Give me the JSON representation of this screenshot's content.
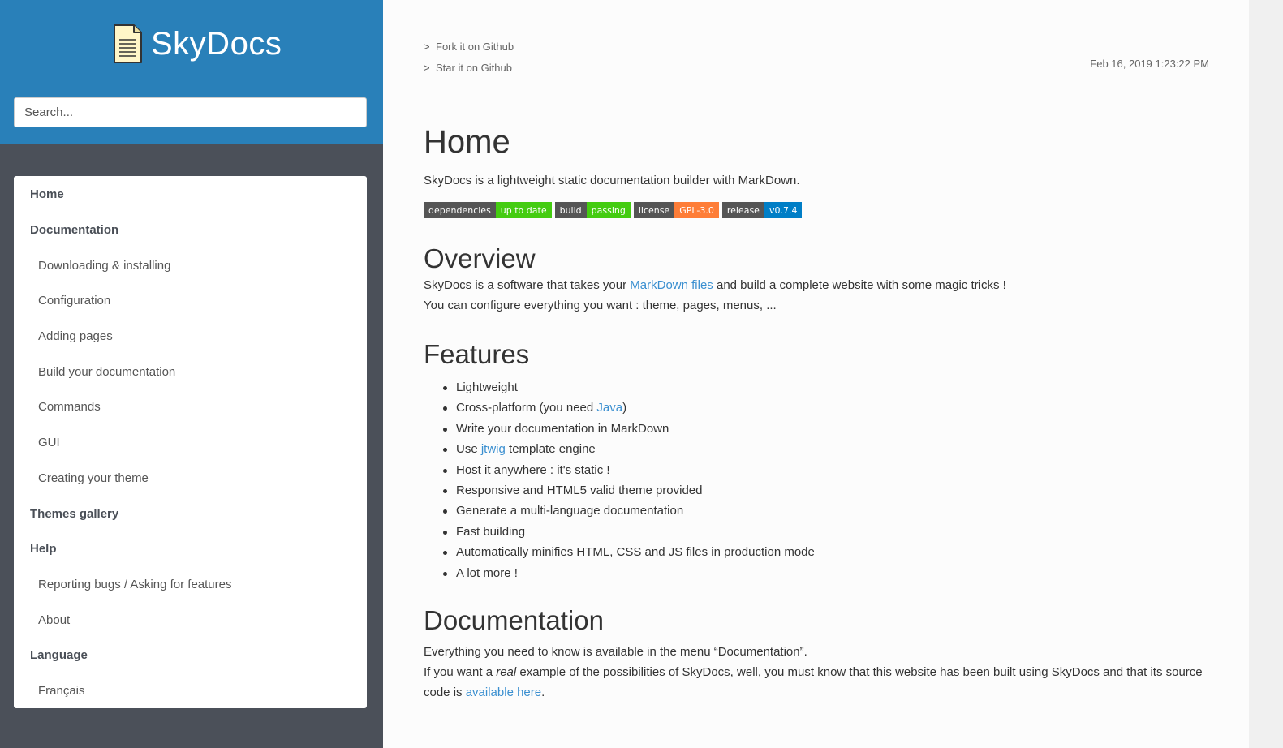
{
  "sidebar": {
    "logo_text": "SkyDocs",
    "search_placeholder": "Search...",
    "items": [
      {
        "label": "Home",
        "level": "top"
      },
      {
        "label": "Documentation",
        "level": "top"
      },
      {
        "label": "Downloading & installing",
        "level": "sub"
      },
      {
        "label": "Configuration",
        "level": "sub"
      },
      {
        "label": "Adding pages",
        "level": "sub"
      },
      {
        "label": "Build your documentation",
        "level": "sub"
      },
      {
        "label": "Commands",
        "level": "sub"
      },
      {
        "label": "GUI",
        "level": "sub"
      },
      {
        "label": "Creating your theme",
        "level": "sub"
      },
      {
        "label": "Themes gallery",
        "level": "top"
      },
      {
        "label": "Help",
        "level": "top"
      },
      {
        "label": "Reporting bugs / Asking for features",
        "level": "sub"
      },
      {
        "label": "About",
        "level": "sub"
      },
      {
        "label": "Language",
        "level": "top"
      },
      {
        "label": "Français",
        "level": "sub"
      }
    ]
  },
  "topbar": {
    "fork_label": "Fork it on Github",
    "star_label": "Star it on Github",
    "arrow": ">",
    "date": "Feb 16, 2019 1:23:22 PM"
  },
  "content": {
    "title": "Home",
    "intro": "SkyDocs is a lightweight static documentation builder with MarkDown.",
    "badges": [
      {
        "label": "dependencies",
        "value": "up to date",
        "color": "#4c1"
      },
      {
        "label": "build",
        "value": "passing",
        "color": "#4c1"
      },
      {
        "label": "license",
        "value": "GPL-3.0",
        "color": "#fe7d37"
      },
      {
        "label": "release",
        "value": "v0.7.4",
        "color": "#007ec6"
      }
    ],
    "overview": {
      "heading": "Overview",
      "p1_before": "SkyDocs is a software that takes your ",
      "p1_link": "MarkDown files",
      "p1_after": " and build a complete website with some magic tricks !",
      "p2": "You can configure everything you want : theme, pages, menus, ..."
    },
    "features": {
      "heading": "Features",
      "items": [
        {
          "text": "Lightweight"
        },
        {
          "before": "Cross-platform (you need ",
          "link": "Java",
          "after": ")"
        },
        {
          "text": "Write your documentation in MarkDown"
        },
        {
          "before": "Use ",
          "link": "jtwig",
          "after": " template engine"
        },
        {
          "text": "Host it anywhere : it's static !"
        },
        {
          "text": "Responsive and HTML5 valid theme provided"
        },
        {
          "text": "Generate a multi-language documentation"
        },
        {
          "text": "Fast building"
        },
        {
          "text": "Automatically minifies HTML, CSS and JS files in production mode"
        },
        {
          "text": "A lot more !"
        }
      ]
    },
    "documentation": {
      "heading": "Documentation",
      "p1": "Everything you need to know is available in the menu “Documentation”.",
      "p2_before": "If you want a ",
      "p2_em": "real",
      "p2_middle": " example of the possibilities of SkyDocs, well, you must know that this website has been built using SkyDocs and that its source code is ",
      "p2_link": "available here",
      "p2_after": "."
    }
  },
  "colors": {
    "header_blue": "#2980b9",
    "sidebar_dark": "#4b5059",
    "link_blue": "#3a8fd0"
  }
}
